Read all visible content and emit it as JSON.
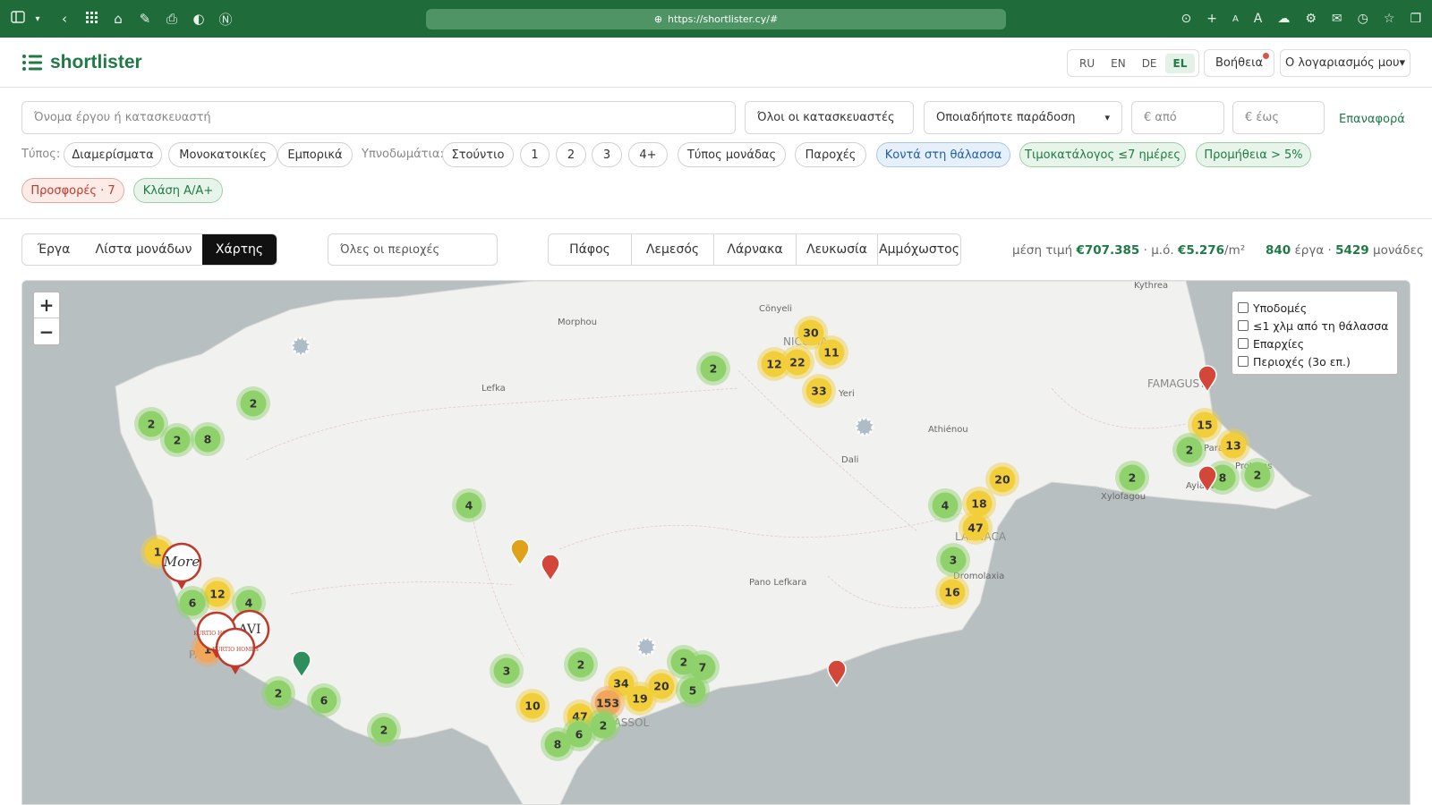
{
  "browser": {
    "url": "https://shortlister.cy/#",
    "left_icons": [
      "sidebar-icon",
      "chevron-down-icon",
      "back-icon",
      "grid-icon",
      "home-icon",
      "extension-icon",
      "printer-icon",
      "shield-icon",
      "notion-icon"
    ],
    "right_icons": [
      "download-icon",
      "plus-icon",
      "font-small-icon",
      "font-large-icon",
      "cloud-icon",
      "gear-icon",
      "mail-icon",
      "history-icon",
      "star-icon",
      "tabs-icon"
    ],
    "font_small": "A",
    "font_large": "A"
  },
  "header": {
    "logo_text": "shortlister",
    "languages": [
      "RU",
      "EN",
      "DE",
      "EL"
    ],
    "active_language": "EL",
    "help_label": "Βοήθεια",
    "account_label": "Ο λογαριασμός μου▾"
  },
  "filters": {
    "search_placeholder": "Όνομα έργου ή κατασκευαστή",
    "developer_value": "Όλοι οι κατασκευαστές",
    "delivery_value": "Οποιαδήποτε παράδοση",
    "price_from_placeholder": "€ από",
    "price_to_placeholder": "€ έως",
    "reset_label": "Επαναφορά",
    "type_label": "Τύπος:",
    "types": [
      "Διαμερίσματα",
      "Μονοκατοικίες",
      "Εμπορικά"
    ],
    "bedrooms_label": "Υπνοδωμάτια:",
    "bedrooms": [
      "Στούντιο",
      "1",
      "2",
      "3",
      "4+"
    ],
    "unit_type": "Τύπος μονάδας",
    "amenities": "Παροχές",
    "near_sea": "Κοντά στη θάλασσα",
    "pricelist": "Τιμοκατάλογος ≤7 ημέρες",
    "commission": "Προμήθεια > 5%",
    "offers": "Προσφορές · 7",
    "energy_class": "Κλάση Α/Α+"
  },
  "view": {
    "tabs": [
      "Έργα",
      "Λίστα μονάδων",
      "Χάρτης"
    ],
    "active_tab": "Χάρτης",
    "area_placeholder": "Όλες οι περιοχές",
    "regions": [
      "Πάφος",
      "Λεμεσός",
      "Λάρνακα",
      "Λευκωσία",
      "Αμμόχωστος"
    ],
    "avg_price_label": "μέση τιμή",
    "avg_price": "€707.385",
    "avg_sqm_label": "μ.ό.",
    "avg_sqm": "€5.276",
    "sqm_unit": "/m²",
    "projects_count": "840",
    "projects_label": "έργα",
    "units_count": "5429",
    "units_label": "μονάδες"
  },
  "map": {
    "zoom_in": "+",
    "zoom_out": "−",
    "layers": [
      "Υποδομές",
      "≤1 χλμ από τη θάλασσα",
      "Επαρχίες",
      "Περιοχές (3ο επ.)"
    ],
    "place_labels": [
      "Morphou",
      "Lefka",
      "Cönyeli",
      "NICOSIA",
      "Yeri",
      "Dali",
      "Athiénou",
      "FAMAGUSTA",
      "Protaras",
      "Xylofagou",
      "LARNACA",
      "Dromolaxia",
      "Pano Lefkara",
      "PAPHOS",
      "LIMASSOL",
      "Kythrea",
      "Paralimni",
      "Ayia Napa"
    ],
    "colors": {
      "green": "#8fd16a",
      "yellow": "#f2cf3a",
      "orange": "#f2a65a",
      "marker_red": "#d2473a",
      "marker_amber": "#e0a21b",
      "marker_teal": "#2f8f5b"
    },
    "clusters": [
      {
        "n": "2"
      },
      {
        "n": "2"
      },
      {
        "n": "2"
      },
      {
        "n": "8"
      },
      {
        "n": "4"
      },
      {
        "n": "2"
      },
      {
        "n": "30"
      },
      {
        "n": "12"
      },
      {
        "n": "22"
      },
      {
        "n": "11"
      },
      {
        "n": "33"
      },
      {
        "n": "15"
      },
      {
        "n": "2"
      },
      {
        "n": "13"
      },
      {
        "n": "8"
      },
      {
        "n": "2"
      },
      {
        "n": "2"
      },
      {
        "n": "20"
      },
      {
        "n": "4"
      },
      {
        "n": "18"
      },
      {
        "n": "47"
      },
      {
        "n": "3"
      },
      {
        "n": "16"
      },
      {
        "n": "1"
      },
      {
        "n": "12"
      },
      {
        "n": "6"
      },
      {
        "n": "4"
      },
      {
        "n": "1"
      },
      {
        "n": "2"
      },
      {
        "n": "6"
      },
      {
        "n": "2"
      },
      {
        "n": "3"
      },
      {
        "n": "2"
      },
      {
        "n": "10"
      },
      {
        "n": "34"
      },
      {
        "n": "153"
      },
      {
        "n": "19"
      },
      {
        "n": "20"
      },
      {
        "n": "2"
      },
      {
        "n": "7"
      },
      {
        "n": "5"
      },
      {
        "n": "47"
      },
      {
        "n": "2"
      },
      {
        "n": "6"
      },
      {
        "n": "8"
      }
    ],
    "brand_markers": [
      "More",
      "AVI",
      "KURTIO HOMES",
      "KURTIO HOMES"
    ]
  }
}
